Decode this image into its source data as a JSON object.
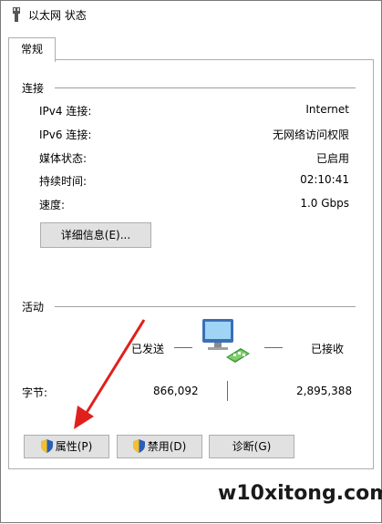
{
  "window": {
    "title": "以太网 状态"
  },
  "tabs": [
    {
      "label": "常规"
    }
  ],
  "connection": {
    "group_title": "连接",
    "rows": [
      {
        "label": "IPv4 连接:",
        "value": "Internet"
      },
      {
        "label": "IPv6 连接:",
        "value": "无网络访问权限"
      },
      {
        "label": "媒体状态:",
        "value": "已启用"
      },
      {
        "label": "持续时间:",
        "value": "02:10:41"
      },
      {
        "label": "速度:",
        "value": "1.0 Gbps"
      }
    ],
    "details_button": "详细信息(E)..."
  },
  "activity": {
    "group_title": "活动",
    "sent_label": "已发送",
    "received_label": "已接收",
    "bytes_label": "字节:",
    "bytes_sent": "866,092",
    "bytes_received": "2,895,388"
  },
  "buttons": {
    "properties": "属性(P)",
    "disable": "禁用(D)",
    "diagnose": "诊断(G)"
  },
  "icons": {
    "title": "network-adapter-icon",
    "activity": "network-computer-icon",
    "uac": "uac-shield-icon"
  },
  "colors": {
    "arrow": "#e0201c",
    "shield_blue": "#2a5fb5",
    "shield_yellow": "#f2c12e"
  },
  "watermark": "w10xitong.com"
}
